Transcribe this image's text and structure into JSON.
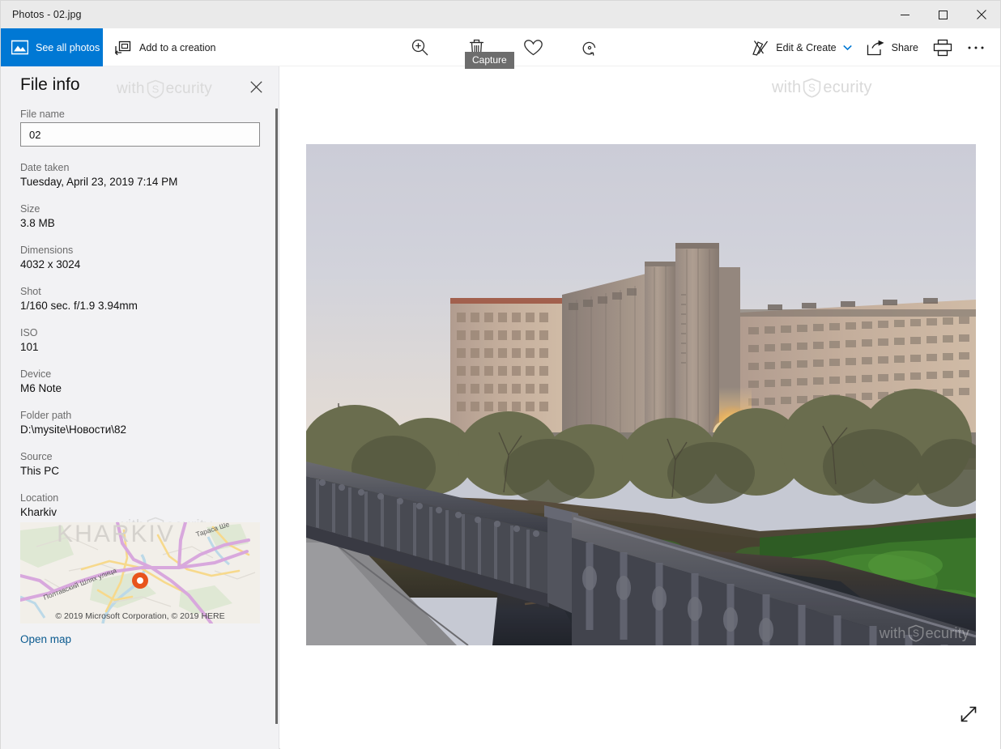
{
  "window": {
    "title": "Photos - 02.jpg",
    "controls": {
      "minimize": "minimize-icon",
      "maximize": "maximize-icon",
      "close": "close-icon"
    }
  },
  "commandbar": {
    "see_all_photos": "See all photos",
    "add_to_creation": "Add to a creation",
    "tooltip": "Capture",
    "tools": [
      {
        "name": "zoom-in-icon",
        "label": "Zoom"
      },
      {
        "name": "delete-icon",
        "label": "Delete"
      },
      {
        "name": "heart-icon",
        "label": "Add to favorites"
      },
      {
        "name": "rotate-icon",
        "label": "Rotate"
      }
    ],
    "edit_create": "Edit & Create",
    "share": "Share",
    "print": "print-icon",
    "more": "See more"
  },
  "fileinfo": {
    "title": "File info",
    "close": "close-icon",
    "fields": [
      {
        "label": "File name",
        "value": "02",
        "type": "input"
      },
      {
        "label": "Date taken",
        "value": "Tuesday, April 23, 2019 7:14 PM"
      },
      {
        "label": "Size",
        "value": "3.8 MB"
      },
      {
        "label": "Dimensions",
        "value": "4032 x 3024"
      },
      {
        "label": "Shot",
        "value": "1/160 sec. f/1.9 3.94mm"
      },
      {
        "label": "ISO",
        "value": "101"
      },
      {
        "label": "Device",
        "value": "M6 Note"
      },
      {
        "label": "Folder path",
        "value": "D:\\mysite\\Новости\\82"
      },
      {
        "label": "Source",
        "value": "This PC"
      },
      {
        "label": "Location",
        "value": "Kharkiv"
      }
    ],
    "map": {
      "credit": "© 2019 Microsoft Corporation, © 2019 HERE",
      "street_1": "Полтавский Шлях улица",
      "street_2": "Тараса Ше",
      "city_label": "KHARKIV",
      "pin_color": "#e8541c",
      "open_map": "Open map"
    }
  },
  "photo": {
    "alt": "Riverside view at sunset with concrete apartment blocks and a stone balustrade bridge railing",
    "expand": "expand-icon"
  },
  "watermark": {
    "text_prefix": "with",
    "text_suffix": "ecurity",
    "shield_letter": "S"
  },
  "colors": {
    "accent": "#0078d4",
    "titlebar": "#eaeaea",
    "panel_bg": "#f2f2f4",
    "link": "#0a5a8f",
    "tooltip_bg": "#6d6d6d",
    "label_text": "#6b6b6b",
    "value_text": "#111111"
  }
}
